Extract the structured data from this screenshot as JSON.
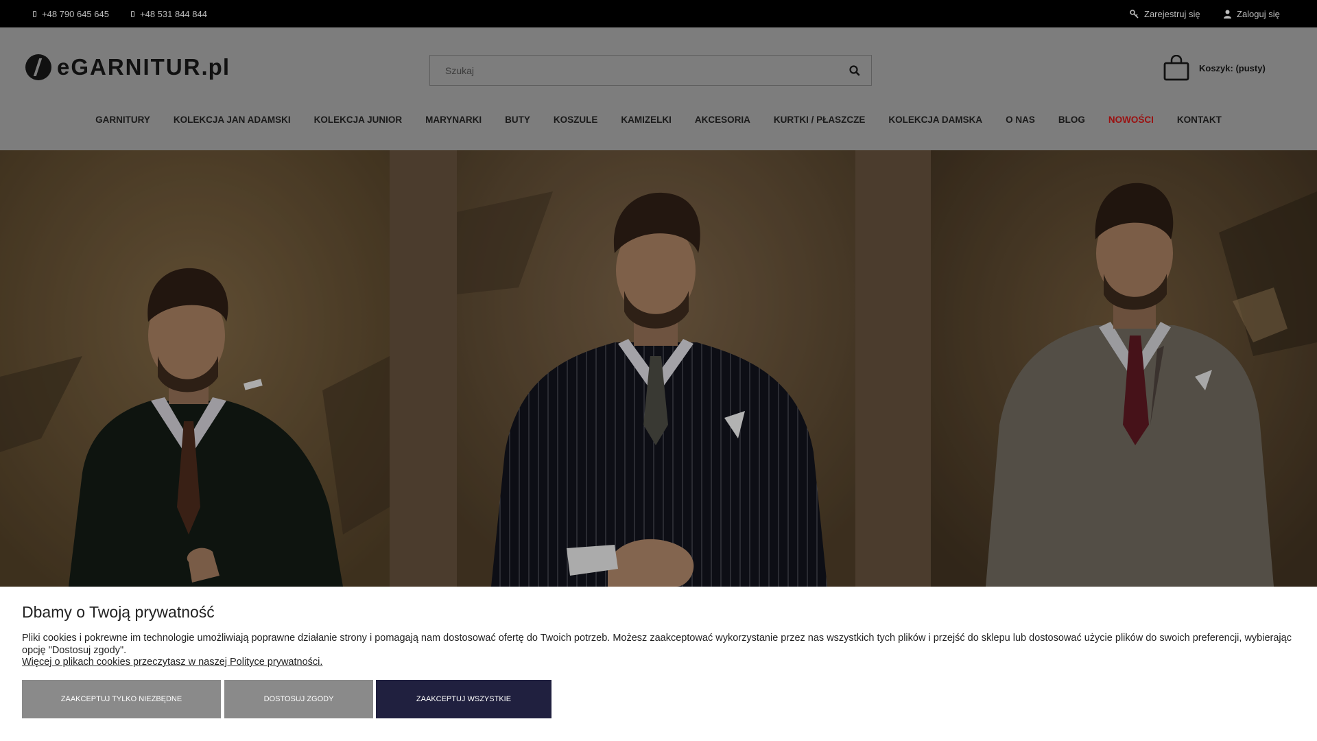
{
  "topbar": {
    "phones": [
      "+48 790 645 645",
      "+48 531 844 844"
    ],
    "register": "Zarejestruj się",
    "login": "Zaloguj się"
  },
  "header": {
    "logo_main": "eGARNITUR",
    "logo_tld": ".pl",
    "search_placeholder": "Szukaj",
    "cart_label": "Koszyk: (pusty)"
  },
  "nav": {
    "items": [
      "GARNITURY",
      "KOLEKCJA JAN ADAMSKI",
      "KOLEKCJA JUNIOR",
      "MARYNARKI",
      "BUTY",
      "KOSZULE",
      "KAMIZELKI",
      "AKCESORIA",
      "KURTKI / PŁASZCZE",
      "KOLEKCJA DAMSKA",
      "O NAS",
      "BLOG",
      "NOWOŚCI",
      "KONTAKT"
    ],
    "highlight_color": "#9b1010"
  },
  "cookie": {
    "title": "Dbamy o Twoją prywatność",
    "text": "Pliki cookies i pokrewne im technologie umożliwiają poprawne działanie strony i pomagają nam dostosować ofertę do Twoich potrzeb. Możesz zaakceptować wykorzystanie przez nas wszystkich tych plików i przejść do sklepu lub dostosować użycie plików do swoich preferencji, wybierając opcję \"Dostosuj zgody\".",
    "link": "Więcej o plikach cookies przeczytasz w naszej Polityce prywatności.",
    "buttons": {
      "necessary": "ZAAKCEPTUJ TYLKO NIEZBĘDNE",
      "customize": "DOSTOSUJ ZGODY",
      "accept_all": "ZAAKCEPTUJ WSZYSTKIE"
    },
    "accent_color": "#20203f"
  }
}
